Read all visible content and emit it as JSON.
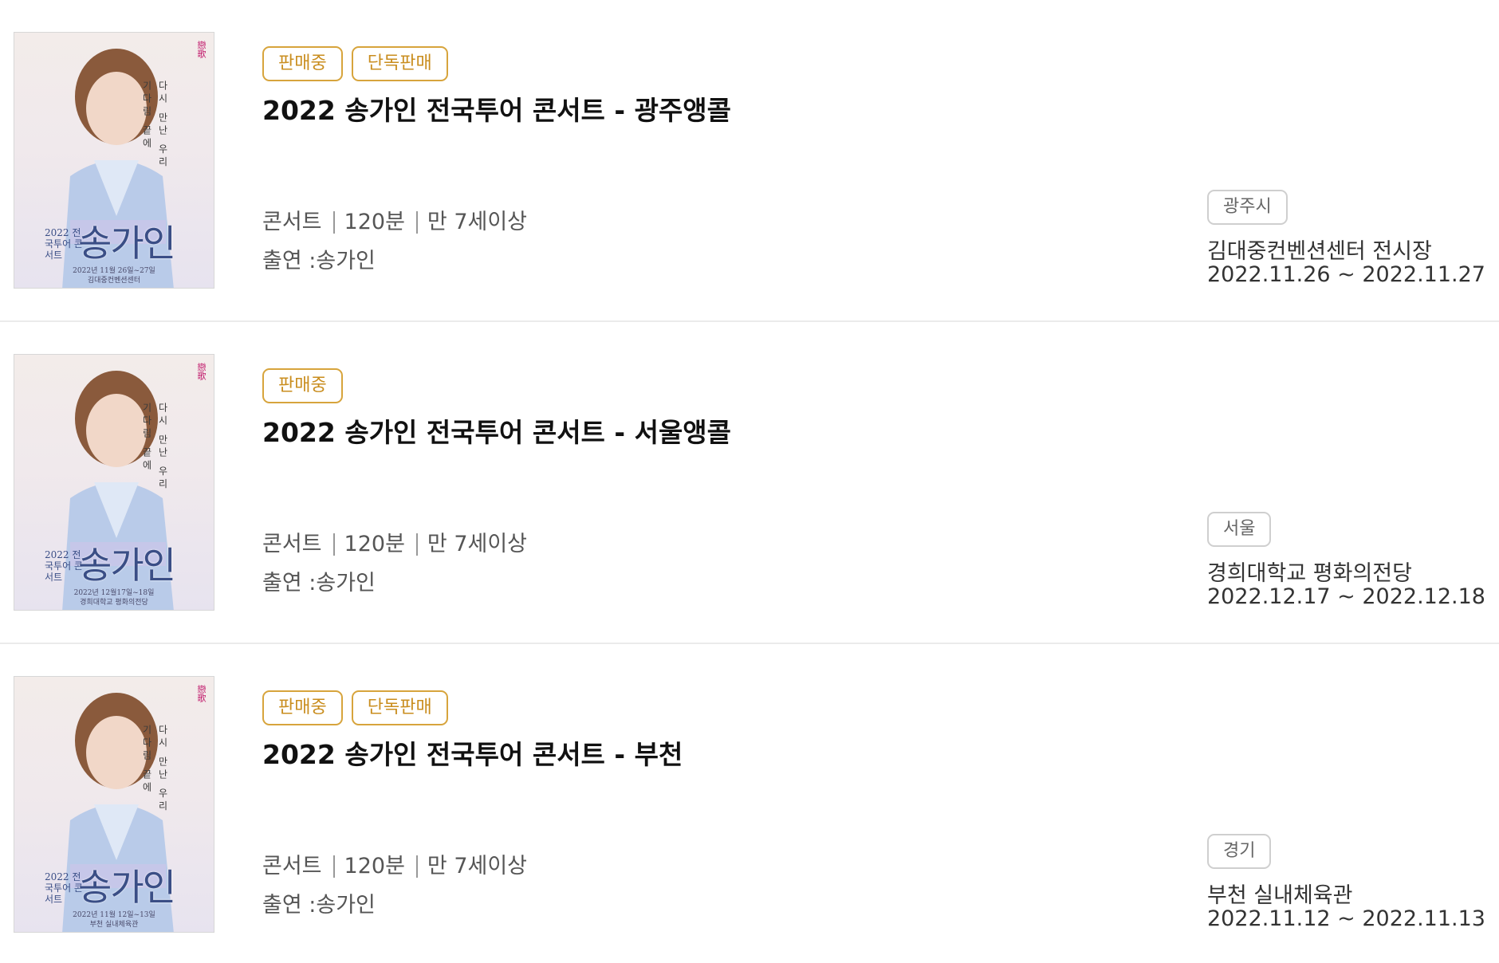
{
  "items": [
    {
      "badges": [
        "판매중",
        "단독판매"
      ],
      "title": "2022 송가인 전국투어 콘서트 - 광주앵콜",
      "genre": "콘서트",
      "runtime": "120분",
      "age": "만 7세이상",
      "cast": "출연 :송가인",
      "region": "광주시",
      "venue": "김대중컨벤션센터 전시장",
      "dates": "2022.11.26 ~ 2022.11.27",
      "poster": {
        "name": "송가인",
        "year_line": "2022 전국투어 콘서트",
        "date_line": "2022년 11월 26일~27일",
        "venue_line": "김대중컨벤션센터"
      }
    },
    {
      "badges": [
        "판매중"
      ],
      "title": "2022 송가인 전국투어 콘서트 - 서울앵콜",
      "genre": "콘서트",
      "runtime": "120분",
      "age": "만 7세이상",
      "cast": "출연 :송가인",
      "region": "서울",
      "venue": "경희대학교 평화의전당",
      "dates": "2022.12.17 ~ 2022.12.18",
      "poster": {
        "name": "송가인",
        "year_line": "2022 전국투어 콘서트",
        "date_line": "2022년 12월17일~18일",
        "venue_line": "경희대학교 평화의전당"
      }
    },
    {
      "badges": [
        "판매중",
        "단독판매"
      ],
      "title": "2022 송가인 전국투어 콘서트 - 부천",
      "genre": "콘서트",
      "runtime": "120분",
      "age": "만 7세이상",
      "cast": "출연 :송가인",
      "region": "경기",
      "venue": "부천 실내체육관",
      "dates": "2022.11.12 ~ 2022.11.13",
      "poster": {
        "name": "송가인",
        "year_line": "2022 전국투어 콘서트",
        "date_line": "2022년 11월 12일~13일",
        "venue_line": "부천 실내체육관"
      }
    }
  ]
}
